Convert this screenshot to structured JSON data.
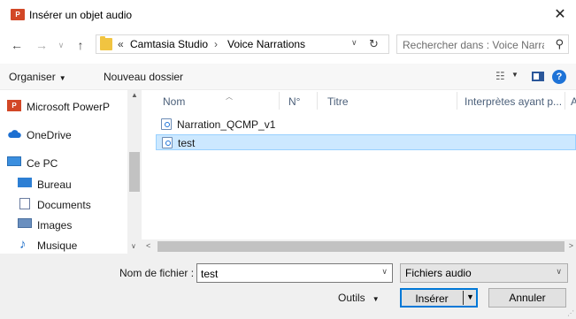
{
  "window": {
    "title": "Insérer un objet audio",
    "app_icon": "powerpoint-icon",
    "close_glyph": "✕"
  },
  "address": {
    "overflow": "«",
    "crumbs": [
      "Camtasia Studio",
      "Voice Narrations"
    ],
    "separator": "›"
  },
  "search": {
    "placeholder": "Rechercher dans : Voice Narra..."
  },
  "toolbar": {
    "organize_label": "Organiser",
    "new_folder_label": "Nouveau dossier"
  },
  "navigation": {
    "items": [
      {
        "label": "Microsoft PowerP",
        "icon": "powerpoint-icon"
      },
      {
        "label": "OneDrive",
        "icon": "cloud-icon"
      },
      {
        "label": "Ce PC",
        "icon": "computer-icon"
      },
      {
        "label": "Bureau",
        "icon": "desktop-icon"
      },
      {
        "label": "Documents",
        "icon": "documents-icon"
      },
      {
        "label": "Images",
        "icon": "images-icon"
      },
      {
        "label": "Musique",
        "icon": "music-icon"
      }
    ]
  },
  "file_list": {
    "columns": [
      "Nom",
      "N°",
      "Titre",
      "Interprètes ayant p...",
      "A"
    ],
    "files": [
      {
        "name": "Narration_QCMP_v1",
        "selected": false
      },
      {
        "name": "test",
        "selected": true
      }
    ]
  },
  "footer": {
    "filename_label": "Nom de fichier :",
    "filename_value": "test",
    "filetype_value": "Fichiers audio",
    "tools_label": "Outils",
    "insert_label": "Insérer",
    "cancel_label": "Annuler"
  },
  "colors": {
    "accent": "#0078d7",
    "selection": "#cce8ff",
    "powerpoint": "#d24726"
  }
}
